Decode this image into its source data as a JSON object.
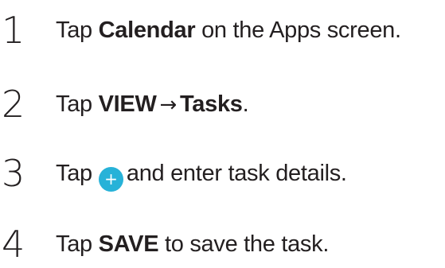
{
  "steps": [
    {
      "number": "1",
      "text_before": "Tap ",
      "bold": "Calendar",
      "text_after": " on the Apps screen."
    },
    {
      "number": "2",
      "text_before": "Tap ",
      "bold_a": "VIEW",
      "arrow": "→",
      "bold_b": "Tasks",
      "text_after": "."
    },
    {
      "number": "3",
      "text_before": "Tap",
      "icon": "add-icon",
      "icon_glyph": "+",
      "icon_color": "#27b2d8",
      "text_after": "and enter task details."
    },
    {
      "number": "4",
      "text_before": "Tap ",
      "bold": "SAVE",
      "text_after": " to save the task."
    }
  ]
}
